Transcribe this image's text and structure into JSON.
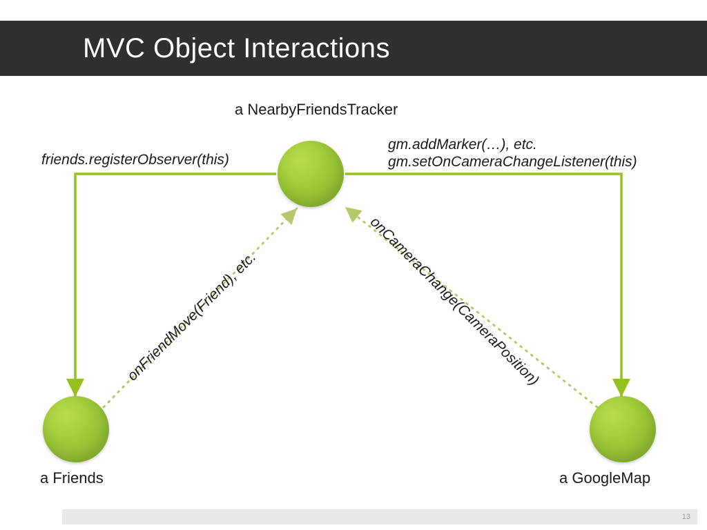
{
  "header": {
    "title": "MVC Object Interactions"
  },
  "nodes": {
    "controller": {
      "label": "a NearbyFriendsTracker"
    },
    "model": {
      "label": "a Friends"
    },
    "view": {
      "label": "a GoogleMap"
    }
  },
  "edges": {
    "ctrl_to_model": {
      "label": "friends.registerObserver(this)"
    },
    "ctrl_to_view_1": {
      "label": "gm.addMarker(…), etc."
    },
    "ctrl_to_view_2": {
      "label": "gm.setOnCameraChangeListener(this)"
    },
    "model_to_ctrl": {
      "label": "onFriendMove(Friend), etc."
    },
    "view_to_ctrl": {
      "label": "onCameraChange(CameraPosition)"
    }
  },
  "colors": {
    "accent": "#95c11f",
    "header_bg": "#2f2f2f"
  },
  "footer": {
    "page_number": "13"
  }
}
